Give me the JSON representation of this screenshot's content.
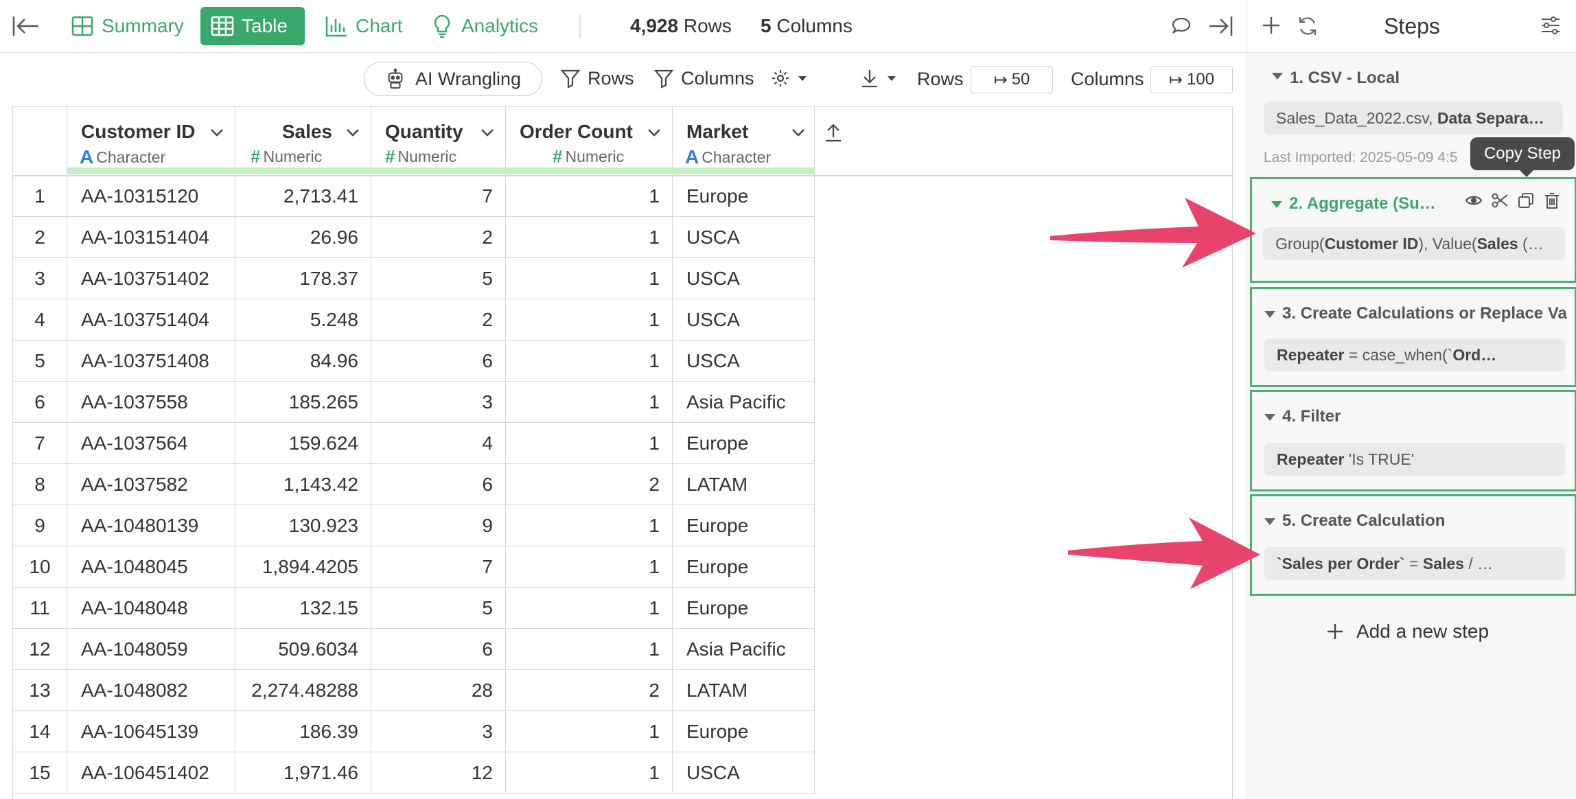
{
  "topbar": {
    "tabs": [
      {
        "label": "Summary"
      },
      {
        "label": "Table"
      },
      {
        "label": "Chart"
      },
      {
        "label": "Analytics"
      }
    ],
    "rows_count": "4,928",
    "rows_word": "Rows",
    "cols_count": "5",
    "cols_word": "Columns"
  },
  "toolbar": {
    "ai_label": "AI Wrangling",
    "rows_filter": "Rows",
    "cols_filter": "Columns",
    "rows_label": "Rows",
    "rows_value": "50",
    "cols_label": "Columns",
    "cols_value": "100"
  },
  "table": {
    "columns": [
      {
        "name": "Customer ID",
        "type": "Character"
      },
      {
        "name": "Sales",
        "type": "Numeric"
      },
      {
        "name": "Quantity",
        "type": "Numeric"
      },
      {
        "name": "Order Count",
        "type": "Numeric"
      },
      {
        "name": "Market",
        "type": "Character"
      }
    ],
    "rows": [
      [
        "1",
        "AA-10315120",
        "2,713.41",
        "7",
        "1",
        "Europe"
      ],
      [
        "2",
        "AA-103151404",
        "26.96",
        "2",
        "1",
        "USCA"
      ],
      [
        "3",
        "AA-103751402",
        "178.37",
        "5",
        "1",
        "USCA"
      ],
      [
        "4",
        "AA-103751404",
        "5.248",
        "2",
        "1",
        "USCA"
      ],
      [
        "5",
        "AA-103751408",
        "84.96",
        "6",
        "1",
        "USCA"
      ],
      [
        "6",
        "AA-1037558",
        "185.265",
        "3",
        "1",
        "Asia Pacific"
      ],
      [
        "7",
        "AA-1037564",
        "159.624",
        "4",
        "1",
        "Europe"
      ],
      [
        "8",
        "AA-1037582",
        "1,143.42",
        "6",
        "2",
        "LATAM"
      ],
      [
        "9",
        "AA-10480139",
        "130.923",
        "9",
        "1",
        "Europe"
      ],
      [
        "10",
        "AA-1048045",
        "1,894.4205",
        "7",
        "1",
        "Europe"
      ],
      [
        "11",
        "AA-1048048",
        "132.15",
        "5",
        "1",
        "Europe"
      ],
      [
        "12",
        "AA-1048059",
        "509.6034",
        "6",
        "1",
        "Asia Pacific"
      ],
      [
        "13",
        "AA-1048082",
        "2,274.48288",
        "28",
        "2",
        "LATAM"
      ],
      [
        "14",
        "AA-10645139",
        "186.39",
        "3",
        "1",
        "Europe"
      ],
      [
        "15",
        "AA-106451402",
        "1,971.46",
        "12",
        "1",
        "USCA"
      ]
    ]
  },
  "panel": {
    "title": "Steps",
    "tooltip": "Copy Step",
    "add_step": "Add a new step",
    "steps": [
      {
        "title": "1. CSV - Local",
        "body_plain": "Sales_Data_2022.csv, ",
        "body_bold": "Data Separa…",
        "meta": "Last Imported: 2025-05-09 4:5"
      },
      {
        "title": "2. Aggregate (Su…",
        "body_a": "Group(",
        "body_b": "Customer ID",
        "body_c": "), Value(",
        "body_d": "Sales",
        "body_e": " (…"
      },
      {
        "title": "3. Create Calculations or Replace Va",
        "body_bold": "Repeater",
        "body_plain": " = case_when(`",
        "body_bold2": "Ord…"
      },
      {
        "title": "4. Filter",
        "body_bold": "Repeater",
        "body_plain": " 'Is TRUE'"
      },
      {
        "title": "5. Create Calculation",
        "body_bold": "`Sales per Order`",
        "body_plain": " = ",
        "body_bold2": "Sales",
        "body_plain2": " / …"
      }
    ]
  },
  "colors": {
    "accent": "#3aa86b",
    "highlight_box": "#4caf72",
    "arrow": "#e8436a"
  }
}
